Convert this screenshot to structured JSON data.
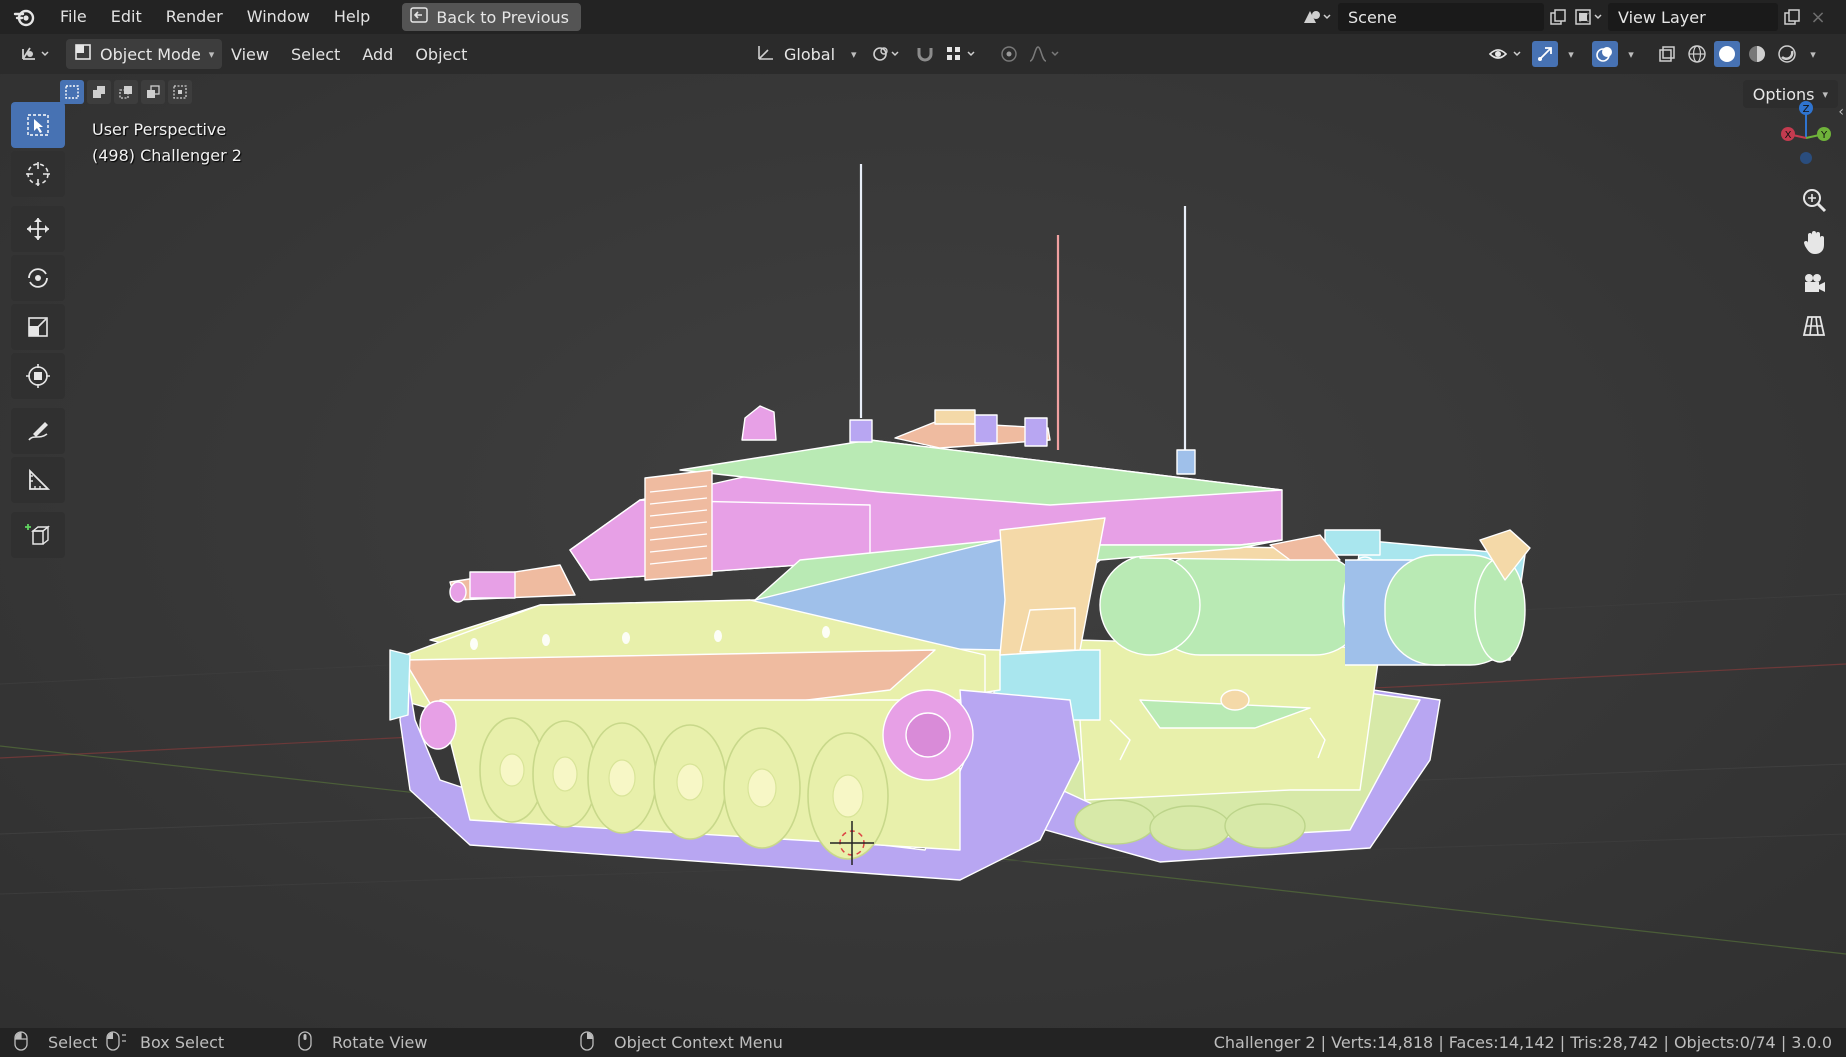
{
  "menu": {
    "items": [
      "File",
      "Edit",
      "Render",
      "Window",
      "Help"
    ],
    "back_button": "Back to Previous"
  },
  "scene": {
    "name": "Scene",
    "layer": "View Layer"
  },
  "header": {
    "mode": "Object Mode",
    "menus": [
      "View",
      "Select",
      "Add",
      "Object"
    ],
    "orientation": "Global",
    "options": "Options"
  },
  "viewport": {
    "view_name": "User Perspective",
    "object_info": "(498) Challenger 2"
  },
  "statusbar": {
    "select": "Select",
    "box_select": "Box Select",
    "rotate_view": "Rotate View",
    "context_menu": "Object Context Menu",
    "stats": "Challenger 2 | Verts:14,818 | Faces:14,142 | Tris:28,742 | Objects:0/74 | 3.0.0"
  },
  "colors": {
    "accent": "#4772b3",
    "pink": "#e7a0e6",
    "green": "#b9eab4",
    "yellow": "#e8f0ab",
    "blue": "#9fc0ea",
    "salmon": "#efbba0",
    "violet": "#b8a6f2",
    "cyan": "#a9e6ee"
  },
  "icons": {
    "logo": "blender-logo-icon",
    "back": "back-arrow-icon",
    "tools": [
      "select-box-icon",
      "cursor-icon",
      "move-icon",
      "rotate-icon",
      "scale-icon",
      "transform-icon",
      "annotate-icon",
      "measure-icon",
      "add-cube-icon"
    ],
    "nav": [
      "zoom-icon",
      "pan-hand-icon",
      "camera-icon",
      "grid-ortho-icon"
    ]
  }
}
